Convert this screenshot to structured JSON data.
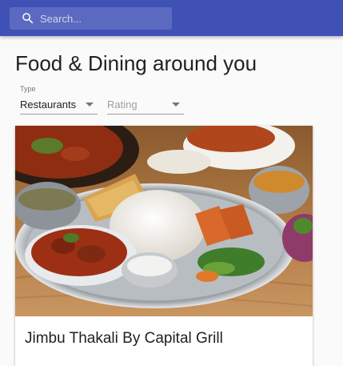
{
  "search": {
    "placeholder": "Search...",
    "value": ""
  },
  "page": {
    "title": "Food & Dining around you"
  },
  "filters": {
    "type": {
      "label": "Type",
      "value": "Restaurants"
    },
    "rating": {
      "placeholder": "Rating"
    }
  },
  "cards": [
    {
      "title": "Jimbu Thakali By Capital Grill",
      "image": "thakali-set-meal-plate"
    }
  ],
  "colors": {
    "appbar": "#3f51b5",
    "text": "#212121",
    "muted": "#757575"
  },
  "icons": {
    "search": "search-icon",
    "dropdown": "arrow-drop-down-icon"
  }
}
